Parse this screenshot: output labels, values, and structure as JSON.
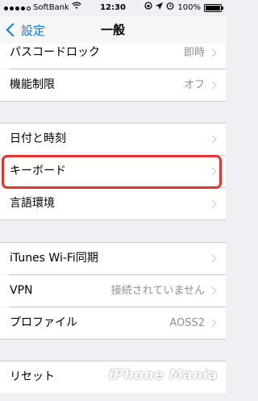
{
  "status": {
    "carrier": "SoftBank",
    "time": "12:30",
    "battery": "100%"
  },
  "nav": {
    "back_label": "設定",
    "title": "一般"
  },
  "rows": [
    {
      "label": "パスコードロック",
      "value": "即時"
    },
    {
      "label": "機能制限",
      "value": "オフ"
    },
    {
      "label": "日付と時刻",
      "value": ""
    },
    {
      "label": "キーボード",
      "value": ""
    },
    {
      "label": "言語環境",
      "value": ""
    },
    {
      "label": "iTunes Wi-Fi同期",
      "value": ""
    },
    {
      "label": "VPN",
      "value": "接続されていません"
    },
    {
      "label": "プロファイル",
      "value": "AOSS2"
    },
    {
      "label": "リセット",
      "value": ""
    }
  ],
  "watermark": "iPhone Mania",
  "colors": {
    "accent": "#007aff",
    "highlight": "#e8332e",
    "background": "#efeff4"
  }
}
